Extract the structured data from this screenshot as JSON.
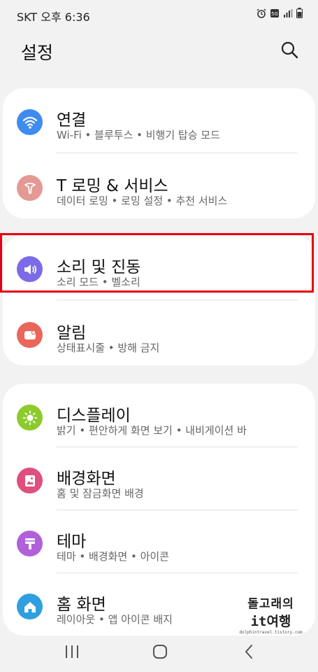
{
  "status": {
    "carrier": "SKT",
    "time": "오후 6:36"
  },
  "header": {
    "title": "설정"
  },
  "sections": [
    {
      "items": [
        {
          "title": "연결",
          "subtitle": "Wi-Fi • 블루투스 • 비행기 탑승 모드",
          "color": "#3f8cf0",
          "icon": "wifi-icon"
        },
        {
          "title": "T 로밍 & 서비스",
          "subtitle": "데이터 로밍 • 로밍 설정 • 추천 서비스",
          "color": "#e59994",
          "icon": "t-roaming-icon"
        }
      ]
    },
    {
      "items": [
        {
          "title": "소리 및 진동",
          "subtitle": "소리 모드 • 벨소리",
          "color": "#7b6be8",
          "icon": "speaker-icon"
        },
        {
          "title": "알림",
          "subtitle": "상태표시줄 • 방해 금지",
          "color": "#e9665b",
          "icon": "notification-icon"
        }
      ]
    },
    {
      "items": [
        {
          "title": "디스플레이",
          "subtitle": "밝기 • 편안하게 화면 보기 • 내비게이션 바",
          "color": "#8ccb2b",
          "icon": "sun-icon"
        },
        {
          "title": "배경화면",
          "subtitle": "홈 및 잠금화면 배경",
          "color": "#e14f7c",
          "icon": "image-icon"
        },
        {
          "title": "테마",
          "subtitle": "테마 • 배경화면 • 아이콘",
          "color": "#b060d9",
          "icon": "paint-brush-icon"
        },
        {
          "title": "홈 화면",
          "subtitle": "레이아웃 • 앱 아이콘 배지",
          "color": "#2e9fe0",
          "icon": "home-icon"
        }
      ]
    }
  ],
  "watermark": {
    "line1": "돌고래의",
    "line2": "it여행",
    "line3": "dolphintravel.tistory.com"
  }
}
